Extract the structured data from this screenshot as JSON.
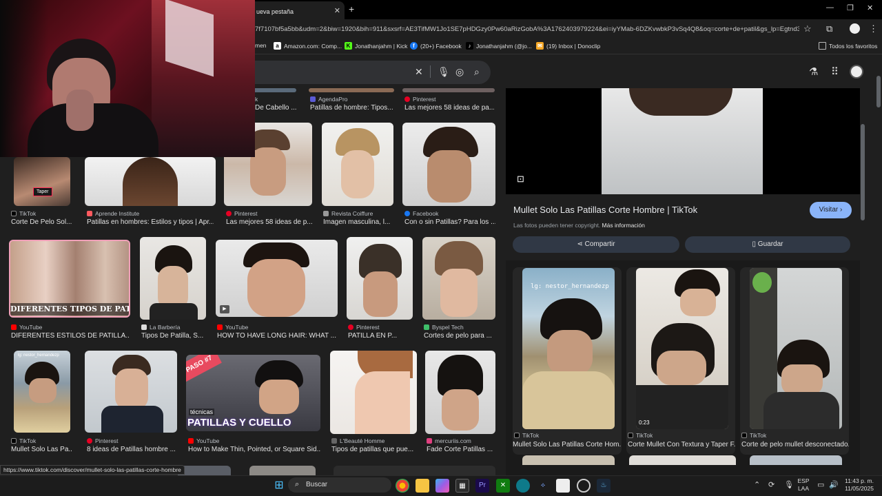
{
  "browser": {
    "tab_title": "ueva pestaña",
    "url": "7f7107bf5a5bb&udm=2&biw=1920&bih=911&sxsrf=AE3TifMW1Jo1SE7pHDGzy0Pw60aRizGobA%3A1762403979224&ei=iyYMab-6DZKvwbkP3vSq4Q8&oq=corte+de+patil&gs_lp=Egtnd3",
    "bookmarks": [
      {
        "label": "men"
      },
      {
        "label": "Amazon.com: Comp...",
        "color": "#ffffff"
      },
      {
        "label": "Jonathanjahm | Kick",
        "color": "#53fc18"
      },
      {
        "label": "(20+) Facebook",
        "color": "#1877f2"
      },
      {
        "label": "Jonathanjahm (@jo...",
        "color": "#000000"
      },
      {
        "label": "(19) Inbox | Donoclip",
        "color": "#f5a623"
      }
    ],
    "all_bookmarks": "Todos los favoritos"
  },
  "grid": {
    "row1": [
      {
        "source": "k",
        "title": "De Cabello ..."
      },
      {
        "source": "AgendaPro",
        "title": "Patillas de hombre: Tipos..."
      },
      {
        "source": "Pinterest",
        "title": "Las mejores 58 ideas de pa..."
      }
    ],
    "row2": [
      {
        "source": "TikTok",
        "title": "Corte De Pelo Sol...",
        "badge": "Taper"
      },
      {
        "source": "Aprende Institute",
        "title": "Patillas en hombres: Estilos y tipos | Apr..."
      },
      {
        "source": "Pinterest",
        "title": "Las mejores 58 ideas de p..."
      },
      {
        "source": "Revista Coiffure",
        "title": "Imagen masculina, l..."
      },
      {
        "source": "Facebook",
        "title": "Con o sin Patillas? Para los ..."
      }
    ],
    "row3": [
      {
        "source": "YouTube",
        "title": "DIFERENTES ESTILOS DE PATILLA...",
        "overlay": "DIFERENTES TIPOS DE PATILLAS"
      },
      {
        "source": "La Barbería",
        "title": "Tipos De Patilla, S..."
      },
      {
        "source": "YouTube",
        "title": "HOW TO HAVE LONG HAIR: WHAT ..."
      },
      {
        "source": "Pinterest",
        "title": "PATILLA EN P..."
      },
      {
        "source": "Byspel Tech",
        "title": "Cortes de pelo para ..."
      }
    ],
    "row4": [
      {
        "source": "TikTok",
        "title": "Mullet Solo Las Pa...",
        "overlay": "lg: nestor_hernandezp"
      },
      {
        "source": "Pinterest",
        "title": "8 ideas de Patillas hombre ..."
      },
      {
        "source": "YouTube",
        "title": "How to Make Thin, Pointed, or Square Sid...",
        "overlay_small": "técnicas",
        "overlay": "PATILLAS Y CUELLO",
        "badge": "PASO #7"
      },
      {
        "source": "L'Beauté Homme",
        "title": "Tipos de patillas que pue..."
      },
      {
        "source": "mercuriis.com",
        "title": "Fade Corte Patillas ..."
      }
    ]
  },
  "panel": {
    "title": "Mullet Solo Las Patillas Corte Hombre | TikTok",
    "visit": "Visitar",
    "copyright": "Las fotos pueden tener copyright.",
    "more_info": "Más información",
    "share": "Compartir",
    "save": "Guardar",
    "related": [
      {
        "source": "TikTok",
        "title": "Mullet Solo Las Patillas Corte Hom...",
        "overlay": "lg: nestor_hernandezp"
      },
      {
        "source": "TikTok",
        "title": "Corte Mullet Con Textura y Taper F...",
        "duration": "0:23"
      },
      {
        "source": "TikTok",
        "title": "Corte de pelo mullet desconectado..."
      }
    ]
  },
  "status_url": "https://www.tiktok.com/discover/mullet-solo-las-patillas-corte-hombre",
  "taskbar": {
    "search": "Buscar",
    "lang1": "ESP",
    "lang2": "LAA",
    "time": "11:43 p. m.",
    "date": "11/05/2025"
  },
  "colors": {
    "accent": "#8ab4f8",
    "tiktok": "#000000",
    "pinterest": "#e60023",
    "youtube": "#ff0000",
    "facebook": "#1877f2"
  }
}
